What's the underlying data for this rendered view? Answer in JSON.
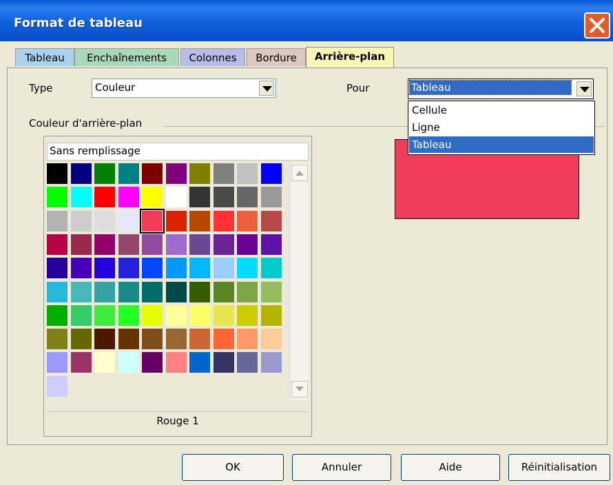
{
  "window": {
    "title": "Format de tableau"
  },
  "tabs": [
    {
      "label": "Tableau",
      "color": "#a9d3ec",
      "active": false
    },
    {
      "label": "Enchaînements",
      "color": "#a9d9b8",
      "active": false
    },
    {
      "label": "Colonnes",
      "color": "#b7bce8",
      "active": false
    },
    {
      "label": "Bordure",
      "color": "#dcc8c0",
      "active": false
    },
    {
      "label": "Arrière-plan",
      "color": "#f7f7b5",
      "active": true
    }
  ],
  "type_field": {
    "label": "Type",
    "value": "Couleur"
  },
  "pour_field": {
    "label": "Pour",
    "value": "Tableau",
    "options": [
      "Cellule",
      "Ligne",
      "Tableau"
    ],
    "selected": "Tableau"
  },
  "background_group": {
    "label": "Couleur d'arrière-plan"
  },
  "palette": {
    "no_fill_label": "Sans remplissage",
    "selected_color_name": "Rouge 1",
    "selected_color": "#f03c5a",
    "colors": [
      "#000000",
      "#000080",
      "#008000",
      "#008080",
      "#800000",
      "#800080",
      "#808000",
      "#808080",
      "#c0c0c0",
      "#0000ff",
      "#00ff00",
      "#00ffff",
      "#ff0000",
      "#ff00ff",
      "#ffff00",
      "#ffffff",
      "#333333",
      "#4a4a4a",
      "#666666",
      "#999999",
      "#b3b3b3",
      "#cccccc",
      "#dddddd",
      "#e6e6ff",
      "#f03c5a",
      "#dc2300",
      "#b84700",
      "#ff3333",
      "#eb613d",
      "#b84747",
      "#b80047",
      "#99284c",
      "#94006b",
      "#94476b",
      "#944a9c",
      "#9c6bce",
      "#6b4794",
      "#6b2394",
      "#6b0094",
      "#5e11a6",
      "#280099",
      "#4700b8",
      "#2300dc",
      "#2323dc",
      "#0047ff",
      "#0099ff",
      "#00b8ff",
      "#99ccff",
      "#00dcff",
      "#00cccc",
      "#23b8dc",
      "#47b8b8",
      "#33a3a3",
      "#198a8a",
      "#006b6b",
      "#004a4a",
      "#355e00",
      "#5c8526",
      "#7da647",
      "#94bd5e",
      "#00ae00",
      "#33cc66",
      "#3deb3d",
      "#23ff23",
      "#e6ff00",
      "#ffff99",
      "#ffff66",
      "#e6e64c",
      "#cccc00",
      "#b3b300",
      "#808019",
      "#666600",
      "#4c1900",
      "#663300",
      "#804c19",
      "#996633",
      "#cc6633",
      "#ff6633",
      "#ff9966",
      "#ffcc99",
      "#9999ff",
      "#993366",
      "#ffffcc",
      "#ccffff",
      "#660066",
      "#ff8080",
      "#0066cc",
      "#333366",
      "#666699",
      "#9999cc",
      "#ccccff"
    ]
  },
  "buttons": {
    "ok": "OK",
    "cancel": "Annuler",
    "help": "Aide",
    "reset": "Réinitialisation"
  }
}
